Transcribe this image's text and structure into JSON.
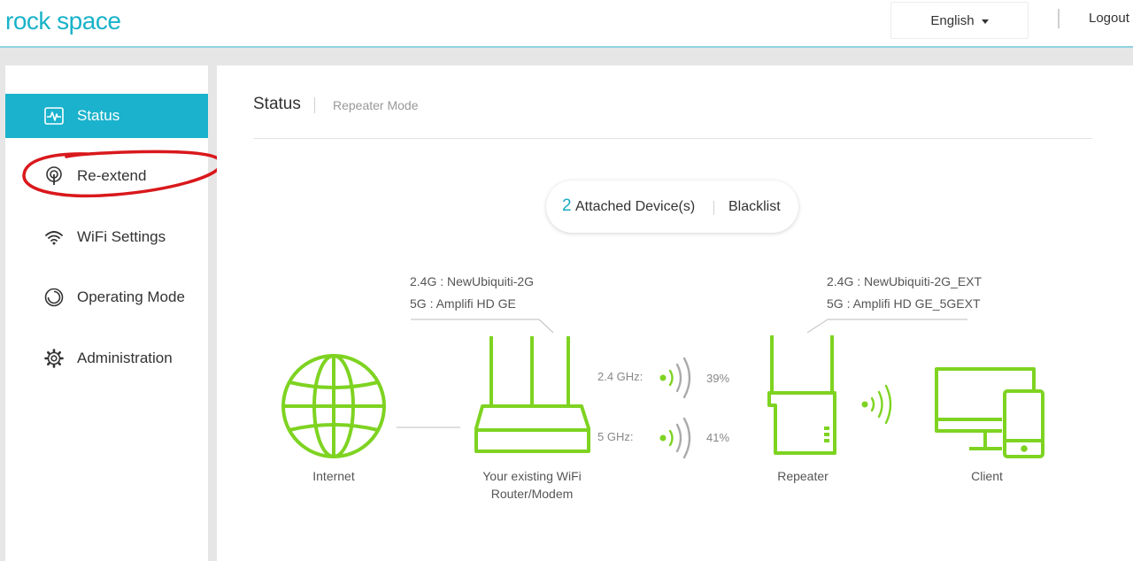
{
  "header": {
    "logo_text": "rock space",
    "language": "English",
    "logout_label": "Logout"
  },
  "sidebar": {
    "items": [
      {
        "label": "Status",
        "icon": "pulse-monitor-icon",
        "active": true
      },
      {
        "label": "Re-extend",
        "icon": "antenna-broadcast-icon",
        "active": false
      },
      {
        "label": "WiFi Settings",
        "icon": "wifi-icon",
        "active": false
      },
      {
        "label": "Operating Mode",
        "icon": "mode-ring-icon",
        "active": false
      },
      {
        "label": "Administration",
        "icon": "gear-icon",
        "active": false
      }
    ]
  },
  "main": {
    "title": "Status",
    "subtitle": "Repeater Mode",
    "attached": {
      "count": "2",
      "label": "Attached Device(s)",
      "blacklist_label": "Blacklist"
    },
    "router_info": {
      "line_24g": "2.4G :  NewUbiquiti-2G",
      "line_5g": "5G :  Amplifi HD GE"
    },
    "repeater_info": {
      "line_24g": "2.4G :  NewUbiquiti-2G_EXT",
      "line_5g": "5G :  Amplifi HD GE_5GEXT"
    },
    "signal": {
      "band_24_label": "2.4 GHz:",
      "band_24_strength": "39%",
      "band_5_label": "5 GHz:",
      "band_5_strength": "41%"
    },
    "captions": {
      "internet": "Internet",
      "router_line1": "Your existing WiFi",
      "router_line2": "Router/Modem",
      "repeater": "Repeater",
      "client": "Client"
    }
  },
  "colors": {
    "accent": "#1ab2cc",
    "device_green": "#7ed321",
    "annotation_red": "#d9181c"
  }
}
